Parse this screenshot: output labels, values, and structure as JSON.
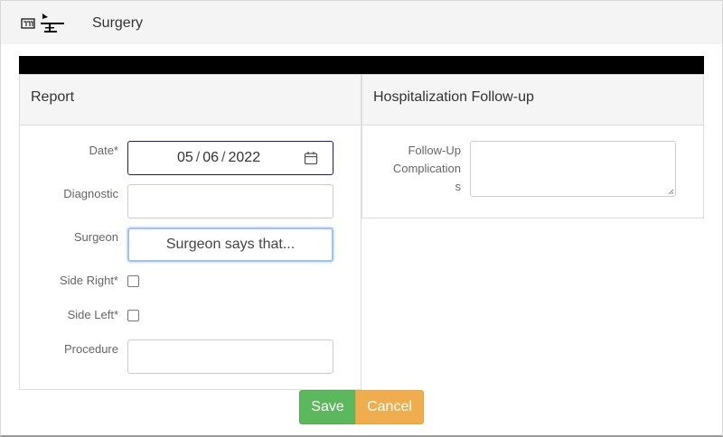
{
  "header": {
    "title": "Surgery",
    "logo_icon": "surgery-table-icon"
  },
  "report": {
    "heading": "Report",
    "date_label": "Date*",
    "date_value": {
      "month": "05",
      "day": "06",
      "year": "2022"
    },
    "diagnostic_label": "Diagnostic",
    "diagnostic_value": "",
    "surgeon_label": "Surgeon",
    "surgeon_button": "Surgeon says that...",
    "side_right_label": "Side Right*",
    "side_right_checked": false,
    "side_left_label": "Side Left*",
    "side_left_checked": false,
    "procedure_label": "Procedure",
    "procedure_value": ""
  },
  "followup": {
    "heading": "Hospitalization Follow-up",
    "complications_label_line1": "Follow-Up",
    "complications_label_line2": "Complication",
    "complications_label_line3": "s",
    "complications_value": ""
  },
  "actions": {
    "save_label": "Save",
    "cancel_label": "Cancel"
  },
  "colors": {
    "save": "#5cb85c",
    "cancel": "#f0ad4e",
    "header_bar": "#000000"
  }
}
